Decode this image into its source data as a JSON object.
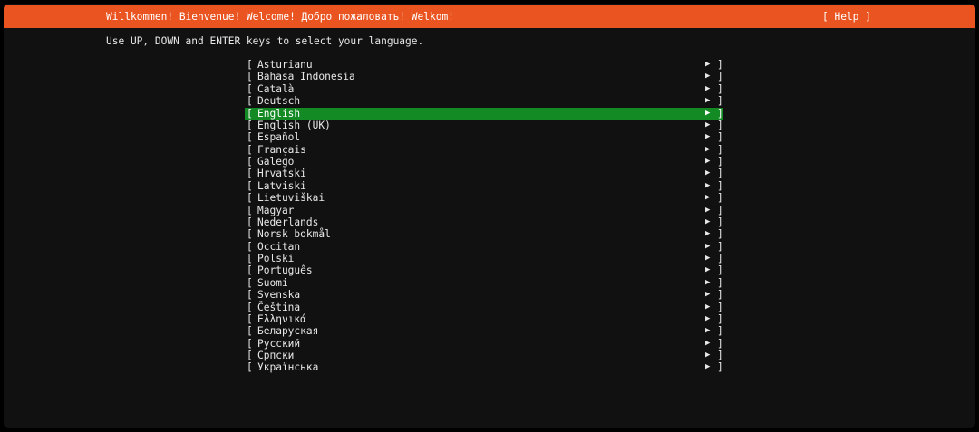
{
  "header": {
    "title": "Willkommen! Bienvenue! Welcome! Добро пожаловать! Welkom!",
    "help_label": "[ Help ]"
  },
  "instructions": "Use UP, DOWN and ENTER keys to select your language.",
  "languages": [
    "Asturianu",
    "Bahasa Indonesia",
    "Català",
    "Deutsch",
    "English",
    "English (UK)",
    "Español",
    "Français",
    "Galego",
    "Hrvatski",
    "Latviski",
    "Lietuviškai",
    "Magyar",
    "Nederlands",
    "Norsk bokmål",
    "Occitan",
    "Polski",
    "Português",
    "Suomi",
    "Svenska",
    "Čeština",
    "Ελληνικά",
    "Беларуская",
    "Русский",
    "Српски",
    "Українська"
  ],
  "selected_language": "English",
  "glyphs": {
    "left_bracket": "[",
    "right_bracket": "]",
    "arrow": "▶"
  },
  "colors": {
    "header_bg": "#e95420",
    "selected_bg": "#138a24",
    "screen_bg": "#111111",
    "text": "#e8e8e8"
  }
}
